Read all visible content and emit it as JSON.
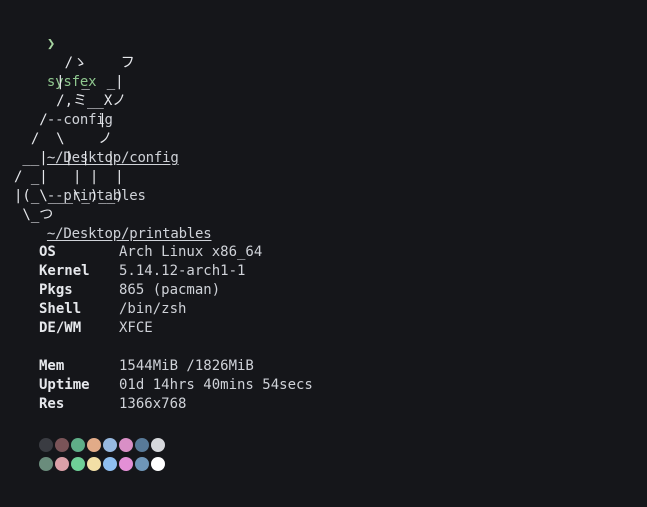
{
  "prompt": {
    "symbol": "❯",
    "command": "sysfex",
    "flag_config": "--config",
    "config_path": "~/Desktop/config",
    "flag_printables": "--printables",
    "printables_path": "~/Desktop/printables"
  },
  "ascii_art": [
    "      /ゝ    フ",
    "     |  _  _|",
    "     /,ミ__Xノ",
    "   /      |",
    "  /  \\    ノ",
    " __|  | |  |",
    "/ _|   | |  |",
    "|(_\\___\\_)__)",
    " \\_つ"
  ],
  "info": {
    "os": {
      "label": "OS",
      "value": "Arch Linux x86_64"
    },
    "kernel": {
      "label": "Kernel",
      "value": "5.14.12-arch1-1"
    },
    "pkgs": {
      "label": "Pkgs",
      "value": "865 (pacman)"
    },
    "shell": {
      "label": "Shell",
      "value": "/bin/zsh"
    },
    "dewm": {
      "label": "DE/WM",
      "value": "XFCE"
    },
    "mem": {
      "label": "Mem",
      "value": "1544MiB /1826MiB"
    },
    "uptime": {
      "label": "Uptime",
      "value": "01d 14hrs 40mins 54secs"
    },
    "res": {
      "label": "Res",
      "value": "1366x768"
    }
  },
  "palette": {
    "row1": [
      "#3a3c42",
      "#7a5458",
      "#5fae88",
      "#e2ab88",
      "#97b9e0",
      "#d98fc6",
      "#587a99",
      "#d6d8dc"
    ],
    "row2": [
      "#6a8c7c",
      "#dba0a8",
      "#6fcf97",
      "#f2dfa6",
      "#8fbff0",
      "#e38fd6",
      "#6f96b8",
      "#ffffff"
    ]
  }
}
